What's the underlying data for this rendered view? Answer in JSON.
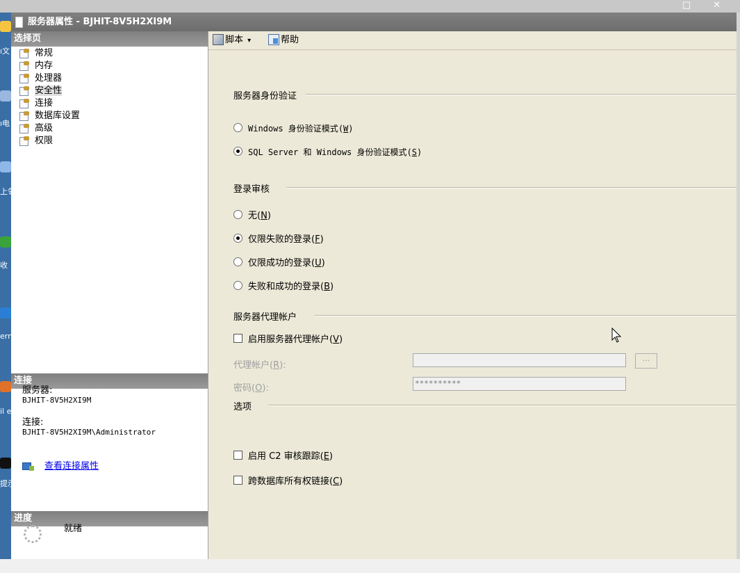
{
  "dialog": {
    "title": "服务器属性 - BJHIT-8V5H2XI9M"
  },
  "left": {
    "select_page_header": "选择页",
    "pages": [
      {
        "label": "常规"
      },
      {
        "label": "内存"
      },
      {
        "label": "处理器"
      },
      {
        "label": "安全性",
        "selected": true
      },
      {
        "label": "连接"
      },
      {
        "label": "数据库设置"
      },
      {
        "label": "高级"
      },
      {
        "label": "权限"
      }
    ],
    "connection_header": "连接",
    "server_label": "服务器:",
    "server_value": "BJHIT-8V5H2XI9M",
    "connection_label": "连接:",
    "connection_value": "BJHIT-8V5H2XI9M\\Administrator",
    "view_conn_link": "查看连接属性",
    "progress_header": "进度",
    "progress_status": "就绪"
  },
  "toolbar": {
    "script_label": "脚本",
    "script_arrow": "▾",
    "help_label": "帮助"
  },
  "auth": {
    "group_label": "服务器身份验证",
    "windows_mode": "Windows 身份验证模式",
    "windows_key": "W",
    "mixed_mode": "SQL Server 和 Windows 身份验证模式",
    "mixed_key": "S",
    "selected": "mixed"
  },
  "audit": {
    "group_label": "登录审核",
    "options": [
      {
        "label": "无",
        "key": "N",
        "selected": false
      },
      {
        "label": "仅限失败的登录",
        "key": "F",
        "selected": true
      },
      {
        "label": "仅限成功的登录",
        "key": "U",
        "selected": false
      },
      {
        "label": "失败和成功的登录",
        "key": "B",
        "selected": false
      }
    ]
  },
  "proxy": {
    "group_label": "服务器代理帐户",
    "enable_label": "启用服务器代理帐户",
    "enable_key": "V",
    "enabled": false,
    "account_label": "代理帐户",
    "account_key": "R",
    "account_value": "",
    "password_label": "密码",
    "password_key": "O",
    "password_value": "**********",
    "browse_label": "..."
  },
  "options": {
    "group_label": "选项",
    "c2_label": "启用 C2 审核跟踪",
    "c2_key": "E",
    "c2_checked": false,
    "chain_label": "跨数据库所有权链接",
    "chain_key": "C",
    "chain_checked": false
  },
  "host": {
    "window_controls": "□ ✕"
  },
  "desktop": {
    "labels": [
      "ו文",
      "ו电",
      "上邻",
      "收",
      "ern .or",
      "il ef",
      "提示"
    ]
  },
  "colors": {
    "title_bar": "#737373",
    "section_header": "#8a8a8a",
    "dialog_bg": "#ece9d8",
    "link": "#0000ee",
    "desktop": "#3a6ea5"
  }
}
